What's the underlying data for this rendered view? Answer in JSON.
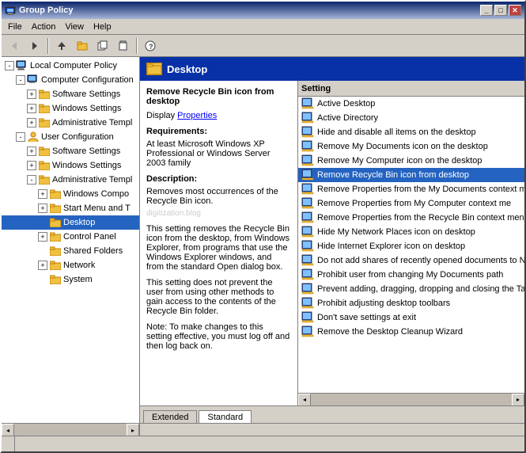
{
  "window": {
    "title": "Group Policy",
    "titleIcon": "policy-icon"
  },
  "menu": {
    "items": [
      "File",
      "Action",
      "View",
      "Help"
    ]
  },
  "toolbar": {
    "buttons": [
      "←",
      "→",
      "⬆",
      "⬇",
      "✕",
      "📋",
      "🔗",
      "❓"
    ]
  },
  "tree": {
    "root": "Local Computer Policy",
    "items": [
      {
        "id": "local-computer-policy",
        "label": "Local Computer Policy",
        "level": 0,
        "expanded": true,
        "icon": "computer"
      },
      {
        "id": "computer-configuration",
        "label": "Computer Configuration",
        "level": 1,
        "expanded": true,
        "icon": "computer"
      },
      {
        "id": "software-settings-1",
        "label": "Software Settings",
        "level": 2,
        "expanded": false,
        "icon": "folder"
      },
      {
        "id": "windows-settings-1",
        "label": "Windows Settings",
        "level": 2,
        "expanded": false,
        "icon": "folder"
      },
      {
        "id": "administrative-templ-1",
        "label": "Administrative Templ",
        "level": 2,
        "expanded": false,
        "icon": "folder"
      },
      {
        "id": "user-configuration",
        "label": "User Configuration",
        "level": 1,
        "expanded": true,
        "icon": "user"
      },
      {
        "id": "software-settings-2",
        "label": "Software Settings",
        "level": 2,
        "expanded": false,
        "icon": "folder"
      },
      {
        "id": "windows-settings-2",
        "label": "Windows Settings",
        "level": 2,
        "expanded": false,
        "icon": "folder"
      },
      {
        "id": "administrative-templ-2",
        "label": "Administrative Templ",
        "level": 2,
        "expanded": true,
        "icon": "folder"
      },
      {
        "id": "windows-compo",
        "label": "Windows Compo",
        "level": 3,
        "expanded": false,
        "icon": "folder"
      },
      {
        "id": "start-menu",
        "label": "Start Menu and T",
        "level": 3,
        "expanded": false,
        "icon": "folder"
      },
      {
        "id": "desktop",
        "label": "Desktop",
        "level": 3,
        "expanded": false,
        "icon": "folder",
        "selected": true
      },
      {
        "id": "control-panel",
        "label": "Control Panel",
        "level": 3,
        "expanded": false,
        "icon": "folder"
      },
      {
        "id": "shared-folders",
        "label": "Shared Folders",
        "level": 3,
        "expanded": false,
        "icon": "folder"
      },
      {
        "id": "network",
        "label": "Network",
        "level": 3,
        "expanded": false,
        "icon": "folder"
      },
      {
        "id": "system",
        "label": "System",
        "level": 3,
        "expanded": false,
        "icon": "folder"
      }
    ]
  },
  "header": {
    "icon": "folder",
    "title": "Desktop"
  },
  "detail": {
    "title": "Remove Recycle Bin icon from desktop",
    "display": "Display",
    "link": "Properties",
    "requirements_title": "Requirements:",
    "requirements": "At least Microsoft Windows XP Professional or Windows Server 2003 family",
    "description_title": "Description:",
    "description": "Removes most occurrences of the Recycle Bin icon.",
    "watermark": "digitization.blog",
    "extra1": "This setting removes the Recycle Bin icon from the desktop, from Windows Explorer, from programs that use the Windows Explorer windows, and from the standard Open dialog box.",
    "extra2": "This setting does not prevent the user from using other methods to gain access to the contents of the Recycle Bin folder.",
    "note": "Note: To make changes to this setting effective, you must log off and then log back on."
  },
  "list": {
    "columnHeader": "Setting",
    "items": [
      {
        "label": "Active Desktop",
        "selected": false
      },
      {
        "label": "Active Directory",
        "selected": false
      },
      {
        "label": "Hide and disable all items on the desktop",
        "selected": false
      },
      {
        "label": "Remove My Documents icon on the desktop",
        "selected": false
      },
      {
        "label": "Remove My Computer icon on the desktop",
        "selected": false
      },
      {
        "label": "Remove Recycle Bin icon from desktop",
        "selected": true
      },
      {
        "label": "Remove Properties from the My Documents context m",
        "selected": false
      },
      {
        "label": "Remove Properties from My Computer context me",
        "selected": false
      },
      {
        "label": "Remove Properties from the Recycle Bin context menu",
        "selected": false
      },
      {
        "label": "Hide My Network Places icon on desktop",
        "selected": false
      },
      {
        "label": "Hide Internet Explorer icon on desktop",
        "selected": false
      },
      {
        "label": "Do not add shares of recently opened documents to N",
        "selected": false
      },
      {
        "label": "Prohibit user from changing My Documents path",
        "selected": false
      },
      {
        "label": "Prevent adding, dragging, dropping and closing the Ta",
        "selected": false
      },
      {
        "label": "Prohibit adjusting desktop toolbars",
        "selected": false
      },
      {
        "label": "Don't save settings at exit",
        "selected": false
      },
      {
        "label": "Remove the Desktop Cleanup Wizard",
        "selected": false
      }
    ]
  },
  "tabs": [
    {
      "label": "Extended",
      "active": false
    },
    {
      "label": "Standard",
      "active": true
    }
  ],
  "statusbar": {
    "text": ""
  }
}
